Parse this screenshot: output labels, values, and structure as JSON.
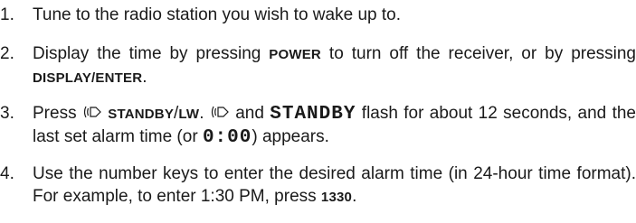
{
  "steps": [
    {
      "num": "1.",
      "parts": [
        {
          "t": "text",
          "v": "Tune to the radio station you wish to wake up to."
        }
      ]
    },
    {
      "num": "2.",
      "parts": [
        {
          "t": "text",
          "v": "Display the time by pressing "
        },
        {
          "t": "key",
          "v": "POWER"
        },
        {
          "t": "text",
          "v": " to turn off the receiver, or by pressing "
        },
        {
          "t": "key",
          "v": "DISPLAY/ENTER"
        },
        {
          "t": "text",
          "v": "."
        }
      ]
    },
    {
      "num": "3.",
      "parts": [
        {
          "t": "text",
          "v": "Press "
        },
        {
          "t": "icon",
          "v": "alarm-icon"
        },
        {
          "t": "text",
          "v": " "
        },
        {
          "t": "key",
          "v": "STANDBY"
        },
        {
          "t": "text",
          "v": "/"
        },
        {
          "t": "key",
          "v": "LW"
        },
        {
          "t": "text",
          "v": ". "
        },
        {
          "t": "icon",
          "v": "alarm-icon"
        },
        {
          "t": "text",
          "v": " and "
        },
        {
          "t": "lcd",
          "v": "STANDBY"
        },
        {
          "t": "text",
          "v": " flash for about 12 seconds, and the last set alarm time (or "
        },
        {
          "t": "lcd",
          "v": "0:00"
        },
        {
          "t": "text",
          "v": ") appears."
        }
      ]
    },
    {
      "num": "4.",
      "parts": [
        {
          "t": "text",
          "v": "Use the number keys to enter the desired alarm time (in 24-hour time format). For example, to enter 1:30 PM, press "
        },
        {
          "t": "key",
          "v": "1330"
        },
        {
          "t": "text",
          "v": "."
        }
      ]
    }
  ]
}
